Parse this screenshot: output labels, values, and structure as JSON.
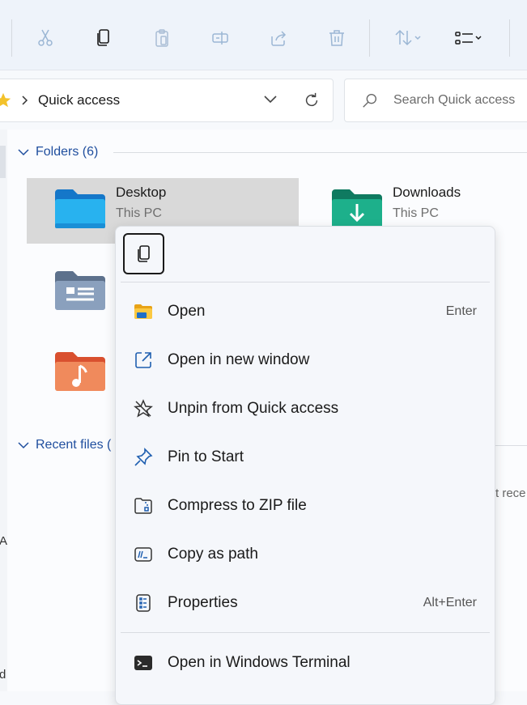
{
  "address_bar": {
    "location": "Quick access"
  },
  "search": {
    "placeholder": "Search Quick access"
  },
  "sections": {
    "folders_label": "Folders (6)",
    "recent_label": "Recent files ("
  },
  "folders": [
    {
      "name": "Desktop",
      "location": "This PC"
    },
    {
      "name": "Downloads",
      "location": "This PC"
    }
  ],
  "context_menu": {
    "items": [
      {
        "label": "Open",
        "shortcut": "Enter",
        "icon": "folder-open-icon"
      },
      {
        "label": "Open in new window",
        "shortcut": "",
        "icon": "open-new-window-icon"
      },
      {
        "label": "Unpin from Quick access",
        "shortcut": "",
        "icon": "unpin-icon"
      },
      {
        "label": "Pin to Start",
        "shortcut": "",
        "icon": "pin-icon"
      },
      {
        "label": "Compress to ZIP file",
        "shortcut": "",
        "icon": "zip-icon"
      },
      {
        "label": "Copy as path",
        "shortcut": "",
        "icon": "copy-path-icon"
      },
      {
        "label": "Properties",
        "shortcut": "Alt+Enter",
        "icon": "properties-icon"
      },
      {
        "label": "Open in Windows Terminal",
        "shortcut": "",
        "icon": "terminal-icon"
      }
    ]
  },
  "edge": {
    "recent_partial": "t rece",
    "left_a": "A",
    "left_d": "d"
  },
  "colors": {
    "accent": "#1f4e9e",
    "folder_blue": "#1b9ee0",
    "selection": "#d9d9d9"
  }
}
